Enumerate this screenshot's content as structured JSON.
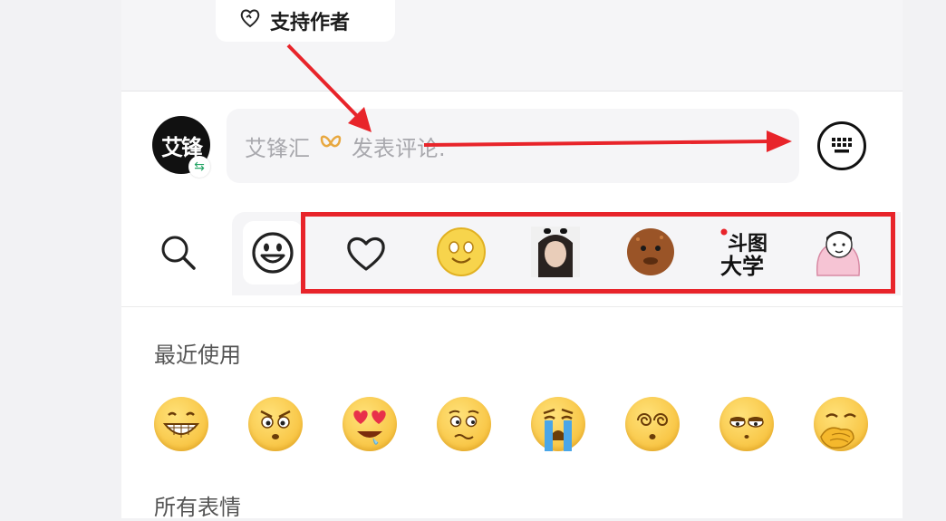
{
  "header": {
    "support_label": "支持作者"
  },
  "comment": {
    "avatar_text": "艾锋",
    "placeholder_user": "艾锋汇",
    "placeholder_text": "发表评论."
  },
  "sections": {
    "recent_title": "最近使用",
    "all_title": "所有表情"
  },
  "sticker_tabs": [
    {
      "icon": "emoji-smile-icon"
    },
    {
      "icon": "heart-outline-icon"
    },
    {
      "icon": "smiley-sticker-icon"
    },
    {
      "icon": "girl-photo-sticker-icon"
    },
    {
      "icon": "brown-face-sticker-icon"
    },
    {
      "icon": "text-sticker-icon",
      "text": "斗图大学"
    },
    {
      "icon": "cartoon-girl-sticker-icon"
    }
  ],
  "recent_emojis": [
    {
      "icon": "grinning-teeth-emoji"
    },
    {
      "icon": "angry-eyes-emoji"
    },
    {
      "icon": "heart-eyes-drool-emoji"
    },
    {
      "icon": "worried-emoji"
    },
    {
      "icon": "crying-emoji"
    },
    {
      "icon": "dizzy-emoji"
    },
    {
      "icon": "unamused-emoji"
    },
    {
      "icon": "hand-over-mouth-emoji"
    }
  ],
  "colors": {
    "highlight": "#e8242a",
    "accent": "#27a567"
  }
}
